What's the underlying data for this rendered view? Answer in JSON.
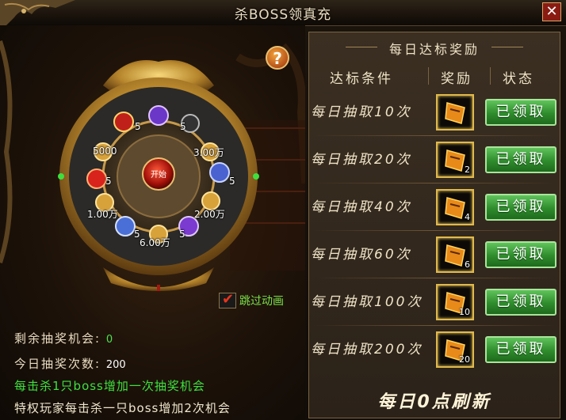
{
  "window": {
    "title": "杀BOSS领真充",
    "close_glyph": "✕"
  },
  "wheel": {
    "center_label": "开始",
    "help_glyph": "?",
    "prize_labels": [
      "5",
      "5",
      "5000",
      "3.00万",
      "5",
      "5",
      "1.00万",
      "2.00万",
      "5",
      "5",
      "6.00万"
    ]
  },
  "skip_animation": {
    "label": "跳过动画",
    "checked": true,
    "check_glyph": "✔"
  },
  "stats": {
    "remaining_label": "剩余抽奖机会:",
    "remaining_value": "0",
    "today_label": "今日抽奖次数:",
    "today_value": "200"
  },
  "notes": {
    "line1": "每击杀1只boss增加一次抽奖机会",
    "line2": "特权玩家每击杀一只boss增加2次机会"
  },
  "rewards_panel": {
    "title": "每日达标奖励",
    "headers": {
      "condition": "达标条件",
      "reward": "奖励",
      "status": "状态"
    },
    "rows": [
      {
        "condition": "每日抽取10次",
        "count": "",
        "status": "已领取"
      },
      {
        "condition": "每日抽取20次",
        "count": "2",
        "status": "已领取"
      },
      {
        "condition": "每日抽取40次",
        "count": "4",
        "status": "已领取"
      },
      {
        "condition": "每日抽取60次",
        "count": "6",
        "status": "已领取"
      },
      {
        "condition": "每日抽取100次",
        "count": "10",
        "status": "已领取"
      },
      {
        "condition": "每日抽取200次",
        "count": "20",
        "status": "已领取"
      }
    ],
    "footer": "每日0点刷新"
  },
  "colors": {
    "claim_green": "#2f8c2c",
    "gold_border": "#e2b94a",
    "note_green": "#3ee03e"
  }
}
